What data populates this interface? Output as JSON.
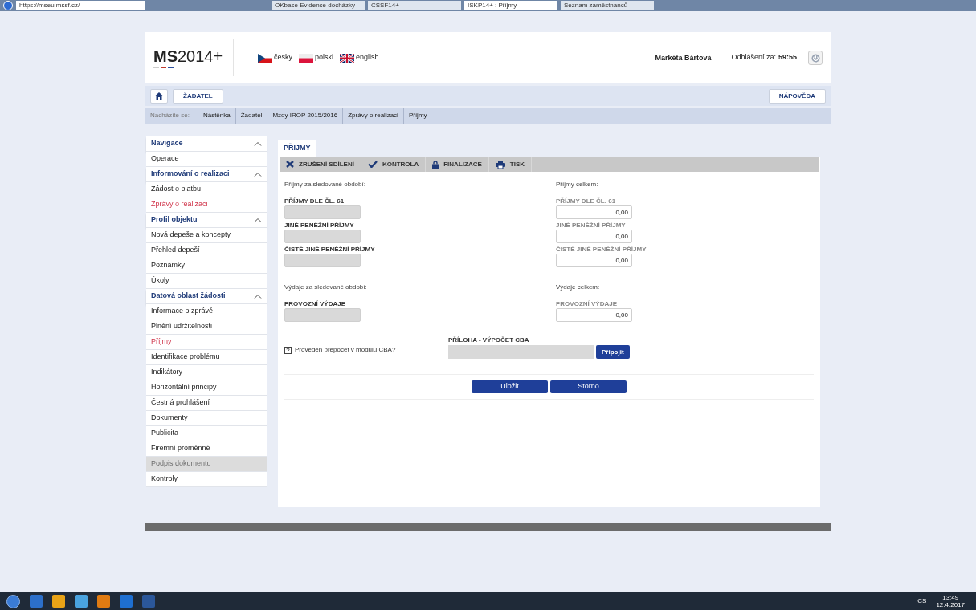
{
  "browser": {
    "address": "https://mseu.mssf.cz/",
    "tabs": [
      {
        "label": "OKbase Evidence docházky",
        "selected": false
      },
      {
        "label": "CSSF14+",
        "selected": false
      },
      {
        "label": "ISKP14+ : Příjmy",
        "selected": true
      },
      {
        "label": "Seznam zaměstnanců",
        "selected": false
      }
    ]
  },
  "header": {
    "logo_bold": "MS",
    "logo_rest": "2014+",
    "languages": [
      {
        "label": "česky",
        "kind": "cz"
      },
      {
        "label": "polski",
        "kind": "pl"
      },
      {
        "label": "english",
        "kind": "en"
      }
    ],
    "user": "Markéta Bártová",
    "logout_label": "Odhlášení za:",
    "logout_time": "59:55"
  },
  "nav": {
    "role_button": "ŽADATEL",
    "help_button": "NÁPOVĚDA"
  },
  "breadcrumb": {
    "label": "Nacházíte se:",
    "items": [
      "Nástěnka",
      "Žadatel",
      "Mzdy IROP 2015/2016",
      "Zprávy o realizaci",
      "Příjmy"
    ]
  },
  "sidebar": [
    {
      "label": "Navigace",
      "kind": "section",
      "selected": false,
      "disabled": false
    },
    {
      "label": "Operace",
      "kind": "item",
      "selected": false,
      "disabled": false
    },
    {
      "label": "Informování o realizaci",
      "kind": "section",
      "selected": false,
      "disabled": false
    },
    {
      "label": "Žádost o platbu",
      "kind": "item",
      "selected": false,
      "disabled": false
    },
    {
      "label": "Zprávy o realizaci",
      "kind": "item",
      "selected": true,
      "disabled": false
    },
    {
      "label": "Profil objektu",
      "kind": "section",
      "selected": false,
      "disabled": false
    },
    {
      "label": "Nová depeše a koncepty",
      "kind": "item",
      "selected": false,
      "disabled": false
    },
    {
      "label": "Přehled depeší",
      "kind": "item",
      "selected": false,
      "disabled": false
    },
    {
      "label": "Poznámky",
      "kind": "item",
      "selected": false,
      "disabled": false
    },
    {
      "label": "Úkoly",
      "kind": "item",
      "selected": false,
      "disabled": false
    },
    {
      "label": "Datová oblast žádosti",
      "kind": "section",
      "selected": false,
      "disabled": false
    },
    {
      "label": "Informace o zprávě",
      "kind": "item",
      "selected": false,
      "disabled": false
    },
    {
      "label": "Plnění udržitelnosti",
      "kind": "item",
      "selected": false,
      "disabled": false
    },
    {
      "label": "Příjmy",
      "kind": "item",
      "selected": true,
      "disabled": false
    },
    {
      "label": "Identifikace problému",
      "kind": "item",
      "selected": false,
      "disabled": false
    },
    {
      "label": "Indikátory",
      "kind": "item",
      "selected": false,
      "disabled": false
    },
    {
      "label": "Horizontální principy",
      "kind": "item",
      "selected": false,
      "disabled": false
    },
    {
      "label": "Čestná prohlášení",
      "kind": "item",
      "selected": false,
      "disabled": false
    },
    {
      "label": "Dokumenty",
      "kind": "item",
      "selected": false,
      "disabled": false
    },
    {
      "label": "Publicita",
      "kind": "item",
      "selected": false,
      "disabled": false
    },
    {
      "label": "Firemní proměnné",
      "kind": "item",
      "selected": false,
      "disabled": false
    },
    {
      "label": "Podpis dokumentu",
      "kind": "item",
      "selected": false,
      "disabled": true
    },
    {
      "label": "Kontroly",
      "kind": "item",
      "selected": false,
      "disabled": false
    }
  ],
  "panel": {
    "tab": "PŘÍJMY",
    "toolbar": [
      {
        "label": "ZRUŠENÍ SDÍLENÍ",
        "kind": "cross"
      },
      {
        "label": "KONTROLA",
        "kind": "check"
      },
      {
        "label": "FINALIZACE",
        "kind": "lock"
      },
      {
        "label": "TISK",
        "kind": "print"
      }
    ],
    "sections": [
      {
        "left_title": "Příjmy za sledované období:",
        "right_title": "Příjmy celkem:",
        "fields": [
          {
            "left_label": "PŘÍJMY DLE ČL. 61",
            "right_label": "PŘÍJMY DLE ČL. 61",
            "right_value": "0,00"
          },
          {
            "left_label": "JINÉ PENĚŽNÍ PŘÍJMY",
            "right_label": "JINÉ PENĚŽNÍ PŘÍJMY",
            "right_value": "0,00"
          },
          {
            "left_label": "ČISTÉ JINÉ PENĚŽNÍ PŘÍJMY",
            "right_label": "ČISTÉ JINÉ PENĚŽNÍ PŘÍJMY",
            "right_value": "0,00"
          }
        ]
      },
      {
        "left_title": "Výdaje za sledované období:",
        "right_title": "Výdaje celkem:",
        "fields": [
          {
            "left_label": "PROVOZNÍ VÝDAJE",
            "right_label": "PROVOZNÍ VÝDAJE",
            "right_value": "0,00"
          }
        ]
      }
    ],
    "cba_question": "Proveden přepočet v modulu CBA?",
    "attachment_label": "PŘÍLOHA - VÝPOČET CBA",
    "attach_button": "Připojit",
    "buttons": [
      "Uložit",
      "Storno"
    ]
  },
  "taskbar": {
    "lang": "CS",
    "time": "13:49",
    "date": "12.4.2017"
  }
}
